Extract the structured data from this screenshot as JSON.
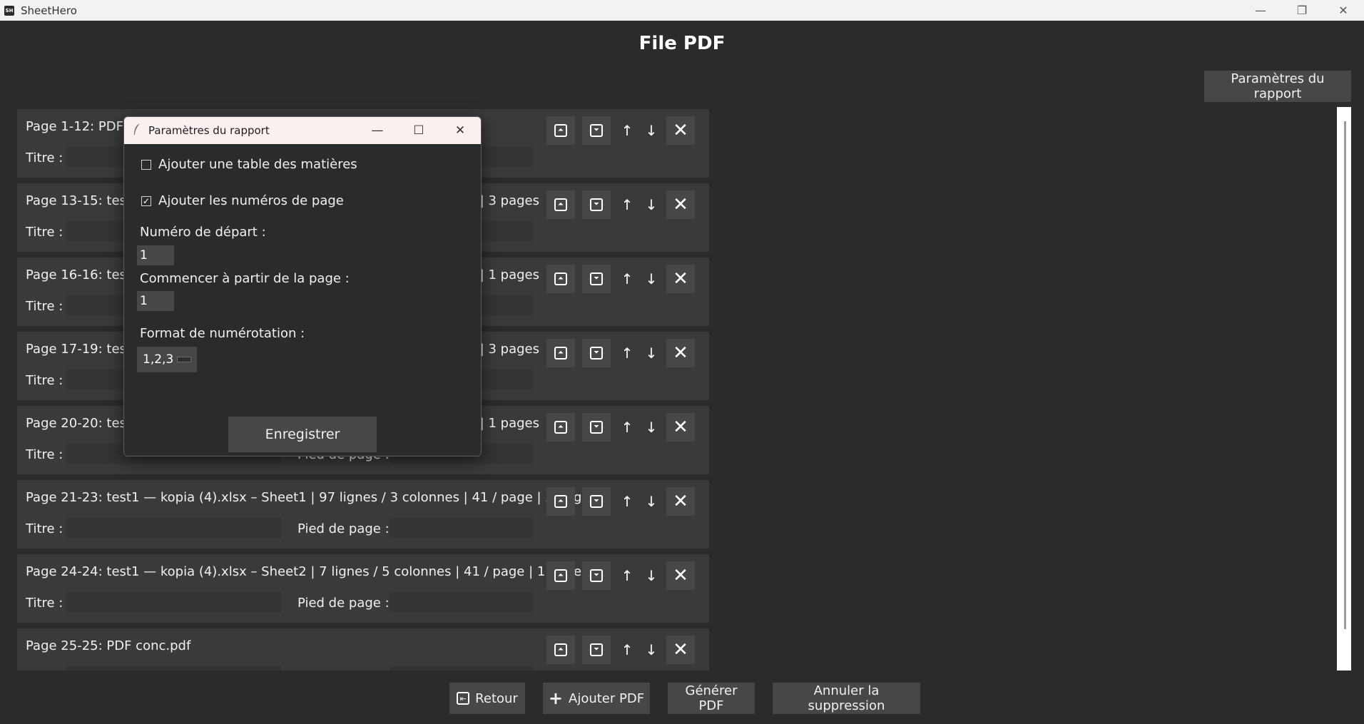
{
  "window": {
    "app_icon_text": "SH",
    "title": "SheetHero",
    "minimize": "—",
    "restore": "❐",
    "close": "✕"
  },
  "page": {
    "title": "File PDF",
    "settings_button": "Paramètres du rapport"
  },
  "labels": {
    "titre": "Titre :",
    "pied": "Pied de page :"
  },
  "icons": {
    "move_top": "move-to-top-icon",
    "move_bottom": "move-to-bottom-icon",
    "up": "↑",
    "down": "↓",
    "remove": "✕"
  },
  "rows": [
    {
      "label": "Page 1-12: PDF i",
      "has_footer": true
    },
    {
      "label": "Page 13-15: test1",
      "suffix": "e | 3 pages",
      "has_footer": true
    },
    {
      "label": "Page 16-16: test1",
      "suffix": "| 1 pages",
      "has_footer": true
    },
    {
      "label": "Page 17-19: test1",
      "suffix": "e | 3 pages",
      "has_footer": true
    },
    {
      "label": "Page 20-20: test1",
      "suffix": "| 1 pages",
      "has_footer": true
    },
    {
      "label": "Page 21-23: test1 — kopia (4).xlsx – Sheet1 | 97 lignes / 3 colonnes | 41 / page | 3 pages",
      "has_footer": true
    },
    {
      "label": "Page 24-24: test1 — kopia (4).xlsx – Sheet2 | 7 lignes / 5 colonnes | 41 / page | 1 pages",
      "has_footer": true
    },
    {
      "label": "Page 25-25: PDF conc.pdf",
      "has_footer": true
    }
  ],
  "bottom_bar": {
    "back": "Retour",
    "add_pdf": "Ajouter PDF",
    "generate": "Générer PDF",
    "undo_delete": "Annuler la suppression"
  },
  "dialog": {
    "title": "Paramètres du rapport",
    "toc_label": "Ajouter une table des matières",
    "toc_checked": false,
    "page_numbers_label": "Ajouter les numéros de page",
    "page_numbers_checked": true,
    "start_number_label": "Numéro de départ :",
    "start_number_value": "1",
    "start_page_label": "Commencer à partir de la page :",
    "start_page_value": "1",
    "format_label": "Format de numérotation :",
    "format_value": "1,2,3",
    "save_button": "Enregistrer",
    "check_mark": "✓"
  }
}
